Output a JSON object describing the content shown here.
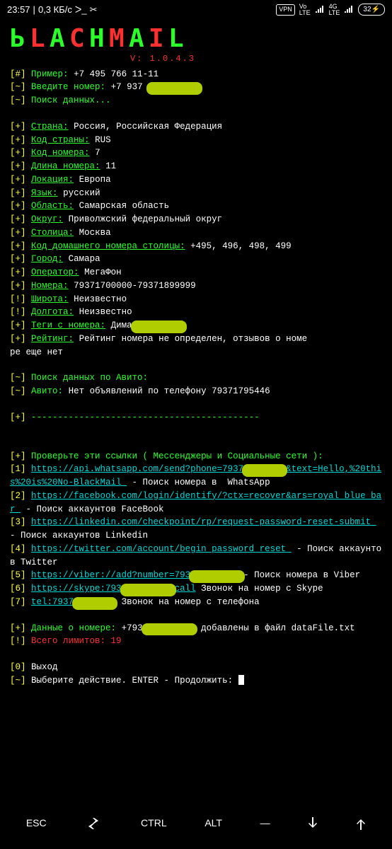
{
  "status": {
    "time": "23:57",
    "speed": "0,3 КБ/с",
    "vpn": "VPN",
    "lte": "4G\nLTE",
    "battery": "32"
  },
  "logo": {
    "version": "V: 1.0.4.3"
  },
  "prompt": {
    "hash": "[#]",
    "tilde": "[~]",
    "plus": "[+]",
    "bang": "[!]",
    "zero": "[0]",
    "one": "[1]",
    "two": "[2]",
    "three": "[3]",
    "four": "[4]",
    "five": "[5]",
    "six": "[6]",
    "seven": "[7]"
  },
  "labels": {
    "example": "Пример:",
    "enter_number": "Введите номер:",
    "searching": "Поиск данных...",
    "country": "Страна:",
    "country_code": "Код страны:",
    "number_code": "Код номера:",
    "number_len": "Длина номера:",
    "location": "Локация:",
    "language": "Язык:",
    "region": "Область:",
    "district": "Округ:",
    "capital": "Столица:",
    "home_code": "Код домашнего номера столицы:",
    "city": "Город:",
    "operator": "Оператор:",
    "numbers": "Номера:",
    "latitude": "Широта:",
    "longitude": "Долгота:",
    "tags": "Теги с номера:",
    "rating": "Рейтинг:",
    "rating_tail": "ре еще нет",
    "avito_search": "Поиск данных по Авито:",
    "avito": "Авито:",
    "check_links": "Проверьте эти ссылки ( Мессенджеры и Социальные сети ):",
    "link1_desc": " - Поиск номера в  WhatsApp",
    "link2_desc": " - Поиск аккаунтов FaceBook",
    "link3_desc": " - Поиск аккаунтов Linkedin",
    "link4_desc": " - Поиск аккаунтов Twitter",
    "link5_desc": "- Поиск номера в Viber",
    "link6_desc": " Звонок на номер с Skype",
    "link7_desc": " Звонок на номер с телефона",
    "data_about": "Данные о номере:",
    "added_to": "добавлены в файл dataFile.txt",
    "limits": "Всего лимитов: 19",
    "exit": "Выход",
    "choose": "Выберите действие. ENTER - Продолжить:"
  },
  "values": {
    "example_num": "+7 495 766 11-11",
    "entered_prefix": "+7 937",
    "country": "Россия, Российская Федерация",
    "country_code": "RUS",
    "number_code": "7",
    "number_len": "11",
    "location": "Европа",
    "language": "русский",
    "region": "Самарская область",
    "district": "Приволжский федеральный округ",
    "capital": "Москва",
    "home_code": "+495, 496, 498, 499",
    "city": "Самара",
    "operator": "МегаФон",
    "numbers": "79371700000-79371899999",
    "latitude": "Неизвестно",
    "longitude": "Неизвестно",
    "tag_name": "Дима",
    "rating": "Рейтинг номера не определен, отзывов о номе",
    "avito": "Нет объявлений по телефону 79371795446",
    "dashes": "-------------------------------------------",
    "link1a": "https://api.whatsapp.com/send?phone=7937",
    "link1b": "&text=Hello,%20this%20is%20No-BlackMail ",
    "link2": "https://facebook.com/login/identify/?ctx=recover&ars=royal_blue_bar ",
    "link3": "https://linkedin.com/checkpoint/rp/request-password-reset-submit ",
    "link4": "https://twitter.com/account/begin_password_reset ",
    "link5": "https://viber://add?number=793",
    "link6": "https://skype:793",
    "link6b": "call",
    "link7": "tel:7937",
    "added_num": "+793"
  },
  "bottombar": {
    "esc": "ESC",
    "ctrl": "CTRL",
    "alt": "ALT"
  }
}
